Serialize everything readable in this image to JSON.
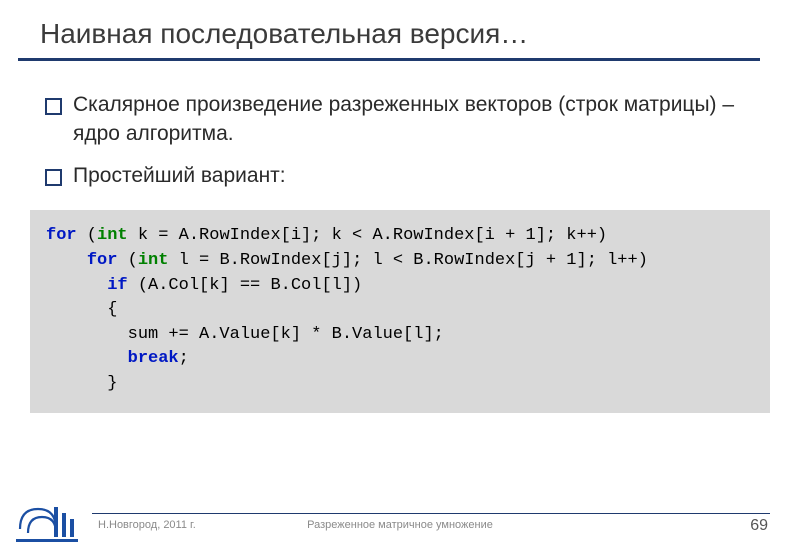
{
  "title": "Наивная последовательная версия…",
  "bullets": [
    "Скалярное произведение разреженных векторов (строк матрицы) – ядро алгоритма.",
    "Простейший вариант:"
  ],
  "code": {
    "line1_for": "for",
    "line1_rest_a": " (",
    "line1_int": "int",
    "line1_rest_b": " k = A.RowIndex[i]; k < A.RowIndex[i + 1]; k++)",
    "line2_pad": "    ",
    "line2_for": "for",
    "line2_rest_a": " (",
    "line2_int": "int",
    "line2_rest_b": " l = B.RowIndex[j]; l < B.RowIndex[j + 1]; l++)",
    "line3_pad": "      ",
    "line3_if": "if",
    "line3_rest": " (A.Col[k] == B.Col[l])",
    "line4": "      {",
    "line5": "        sum += A.Value[k] * B.Value[l];",
    "line6_pad": "        ",
    "line6_break": "break",
    "line6_semi": ";",
    "line7": "      }"
  },
  "footer": {
    "left": "Н.Новгород, 2011 г.",
    "center": "Разреженное матричное умножение",
    "page": "69"
  },
  "logo_name": "unn-logo"
}
